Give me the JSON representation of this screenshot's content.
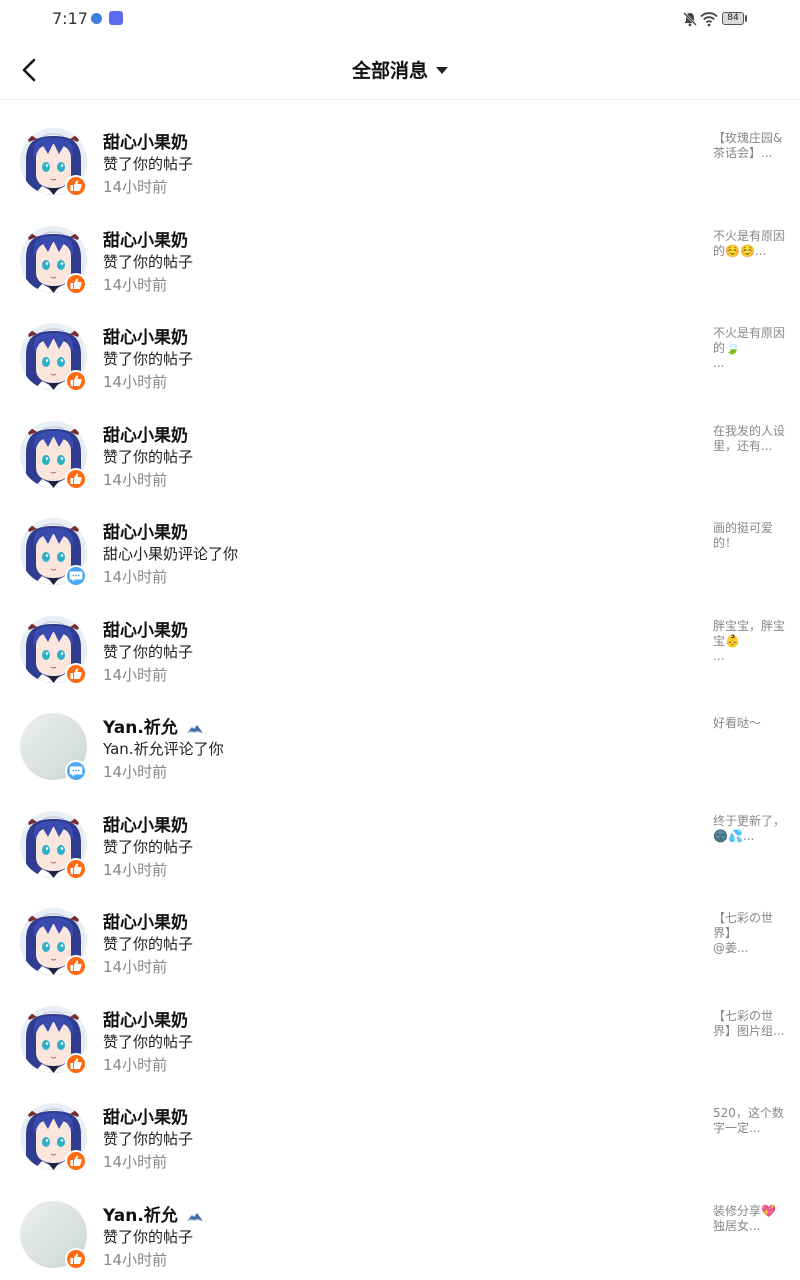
{
  "status_bar": {
    "time": "7:17",
    "battery": "84"
  },
  "header": {
    "title": "全部消息",
    "dropdown_icon": "caret-down-icon",
    "back_icon": "chevron-left-icon"
  },
  "messages": [
    {
      "user": "甜心小果奶",
      "avatar": "anime",
      "action": "赞了你的帖子",
      "time": "14小时前",
      "type": "like",
      "preview": "【玫瑰庄园&茶话会】..."
    },
    {
      "user": "甜心小果奶",
      "avatar": "anime",
      "action": "赞了你的帖子",
      "time": "14小时前",
      "type": "like",
      "preview": "不火是有原因的☺️☺️..."
    },
    {
      "user": "甜心小果奶",
      "avatar": "anime",
      "action": "赞了你的帖子",
      "time": "14小时前",
      "type": "like",
      "preview": "不火是有原因的🍃\n..."
    },
    {
      "user": "甜心小果奶",
      "avatar": "anime",
      "action": "赞了你的帖子",
      "time": "14小时前",
      "type": "like",
      "preview": "在我发的人设里，还有..."
    },
    {
      "user": "甜心小果奶",
      "avatar": "anime",
      "action": "甜心小果奶评论了你",
      "time": "14小时前",
      "type": "comment",
      "preview": "画的挺可爱的！"
    },
    {
      "user": "甜心小果奶",
      "avatar": "anime",
      "action": "赞了你的帖子",
      "time": "14小时前",
      "type": "like",
      "preview": "胖宝宝，胖宝宝👶\n..."
    },
    {
      "user": "Yan.祈允",
      "avatar": "blank",
      "action": "Yan.祈允评论了你",
      "time": "14小时前",
      "type": "comment",
      "preview": "好看哒～",
      "cloud": true
    },
    {
      "user": "甜心小果奶",
      "avatar": "anime",
      "action": "赞了你的帖子",
      "time": "14小时前",
      "type": "like",
      "preview": "终于更新了，🌚💦..."
    },
    {
      "user": "甜心小果奶",
      "avatar": "anime",
      "action": "赞了你的帖子",
      "time": "14小时前",
      "type": "like",
      "preview": "【七彩の世界】\n@姜..."
    },
    {
      "user": "甜心小果奶",
      "avatar": "anime",
      "action": "赞了你的帖子",
      "time": "14小时前",
      "type": "like",
      "preview": "【七彩の世界】图片组..."
    },
    {
      "user": "甜心小果奶",
      "avatar": "anime",
      "action": "赞了你的帖子",
      "time": "14小时前",
      "type": "like",
      "preview": "520，这个数字一定..."
    },
    {
      "user": "Yan.祈允",
      "avatar": "blank",
      "action": "赞了你的帖子",
      "time": "14小时前",
      "type": "like",
      "preview": "装修分享💖独居女...",
      "cloud": true
    }
  ]
}
